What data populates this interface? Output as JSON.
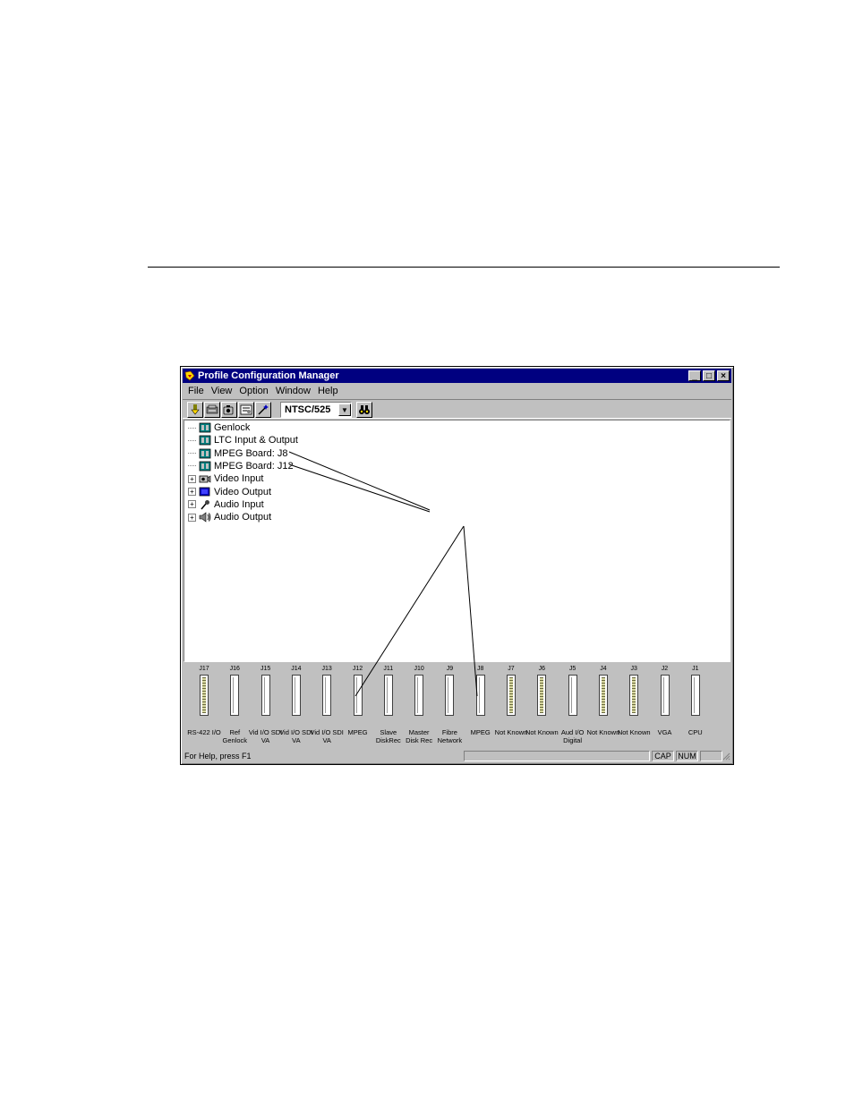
{
  "window": {
    "title": "Profile Configuration Manager",
    "caption_buttons": {
      "minimize": "_",
      "maximize": "□",
      "close": "×"
    }
  },
  "menu": [
    "File",
    "View",
    "Option",
    "Window",
    "Help"
  ],
  "toolbar": {
    "buttons": [
      "import-icon",
      "board-icon",
      "camera-icon",
      "settings-icon",
      "wizard-icon"
    ],
    "standard": "NTSC/525",
    "find_button": "binoculars-icon"
  },
  "tree": [
    {
      "label": "Genlock",
      "icon": "board-icon",
      "expandable": false
    },
    {
      "label": "LTC Input & Output",
      "icon": "board-icon",
      "expandable": false
    },
    {
      "label": "MPEG Board: J8",
      "icon": "board-icon",
      "expandable": false
    },
    {
      "label": "MPEG Board: J12",
      "icon": "board-icon",
      "expandable": false
    },
    {
      "label": "Video Input",
      "icon": "camera-icon",
      "expandable": true
    },
    {
      "label": "Video Output",
      "icon": "monitor-icon",
      "expandable": true
    },
    {
      "label": "Audio Input",
      "icon": "microphone-icon",
      "expandable": true
    },
    {
      "label": "Audio Output",
      "icon": "speaker-icon",
      "expandable": true
    }
  ],
  "slots": [
    {
      "id": "J17",
      "name": "RS-422 I/O",
      "populated": true
    },
    {
      "id": "J16",
      "name": "Ref Genlock",
      "populated": false
    },
    {
      "id": "J15",
      "name": "Vid I/O SDI VA",
      "populated": false
    },
    {
      "id": "J14",
      "name": "Vid I/O SDI VA",
      "populated": false
    },
    {
      "id": "J13",
      "name": "Vid I/O SDI VA",
      "populated": false
    },
    {
      "id": "J12",
      "name": "MPEG",
      "populated": false
    },
    {
      "id": "J11",
      "name": "Slave DiskRec",
      "populated": false
    },
    {
      "id": "J10",
      "name": "Master Disk Rec",
      "populated": false
    },
    {
      "id": "J9",
      "name": "Fibre Network",
      "populated": false
    },
    {
      "id": "J8",
      "name": "MPEG",
      "populated": false
    },
    {
      "id": "J7",
      "name": "Not Known",
      "populated": true
    },
    {
      "id": "J6",
      "name": "Not Known",
      "populated": true
    },
    {
      "id": "J5",
      "name": "Aud I/O Digital",
      "populated": false
    },
    {
      "id": "J4",
      "name": "Not Known",
      "populated": true
    },
    {
      "id": "J3",
      "name": "Not Known",
      "populated": true
    },
    {
      "id": "J2",
      "name": "VGA",
      "populated": false
    },
    {
      "id": "J1",
      "name": "CPU",
      "populated": false
    }
  ],
  "status": {
    "message": "For Help, press F1",
    "caps": "CAP",
    "num": "NUM"
  }
}
